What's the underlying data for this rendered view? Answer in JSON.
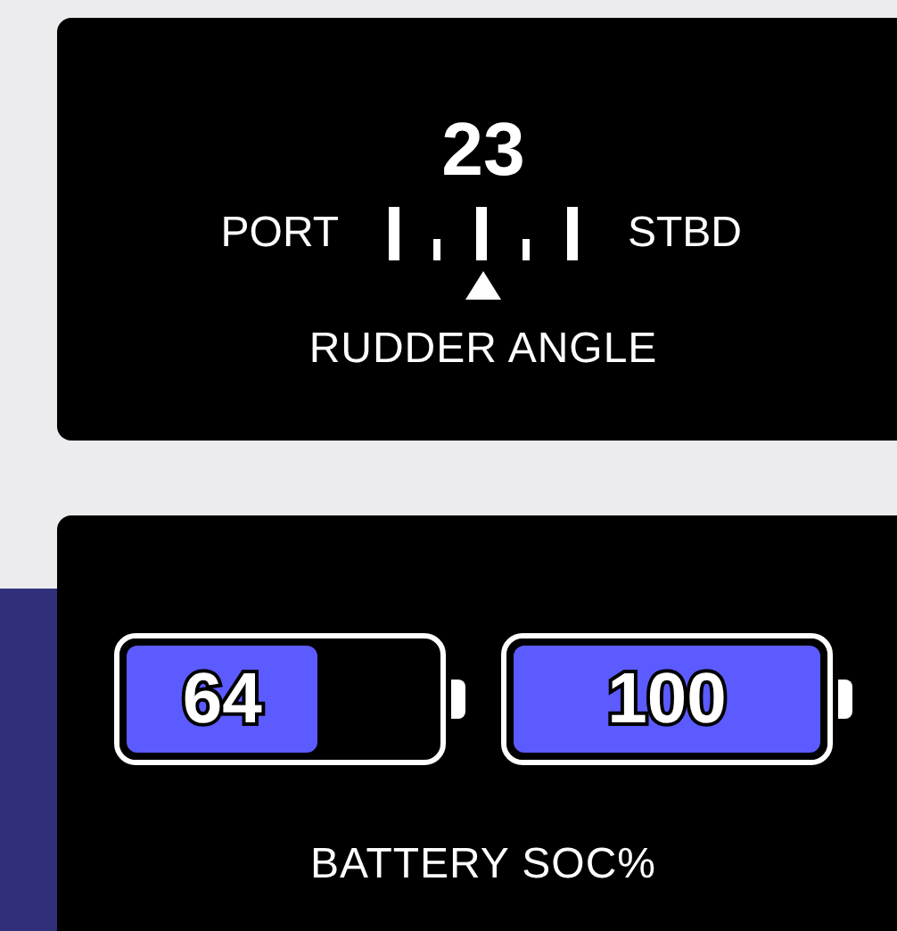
{
  "rudder": {
    "value": "23",
    "port_label": "PORT",
    "stbd_label": "STBD",
    "title": "RUDDER ANGLE"
  },
  "battery": {
    "title": "BATTERY SOC%",
    "batteries": [
      {
        "reading": "64",
        "level": 0.64
      },
      {
        "reading": "100",
        "level": 1.0
      }
    ]
  }
}
